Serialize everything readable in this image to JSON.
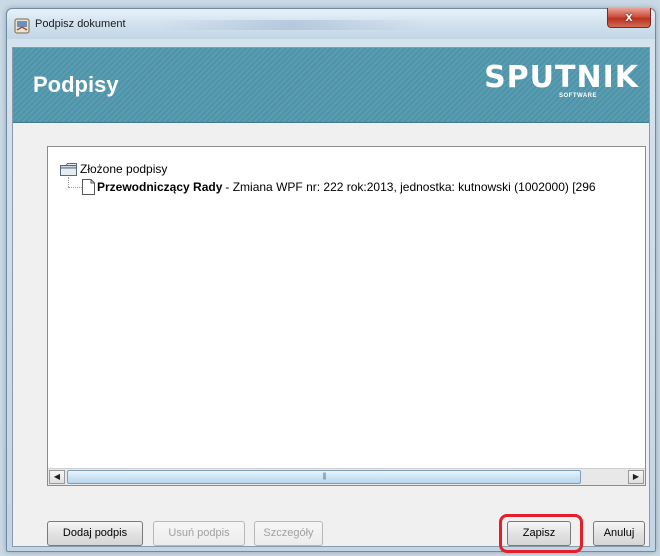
{
  "window": {
    "title": "Podpisz dokument",
    "close_label": "x"
  },
  "banner": {
    "title": "Podpisy",
    "logo_word": "SPUTNIK",
    "logo_sub": "SOFTWARE"
  },
  "tree": {
    "root_label": "Złożone podpisy",
    "child_bold": "Przewodniczący Rady",
    "child_rest": "- Zmiana WPF nr: 222 rok:2013, jednostka: kutnowski (1002000) [296"
  },
  "scrollbar": {
    "left_arrow": "◀",
    "right_arrow": "▶",
    "thumb_grip": "|||"
  },
  "buttons": {
    "add_signature": "Dodaj podpis",
    "remove_signature": "Usuń podpis",
    "details": "Szczegóły",
    "save": "Zapisz",
    "cancel": "Anuluj"
  },
  "colors": {
    "banner": "#5a9db2",
    "highlight": "#e3202a",
    "close": "#d0503e"
  }
}
